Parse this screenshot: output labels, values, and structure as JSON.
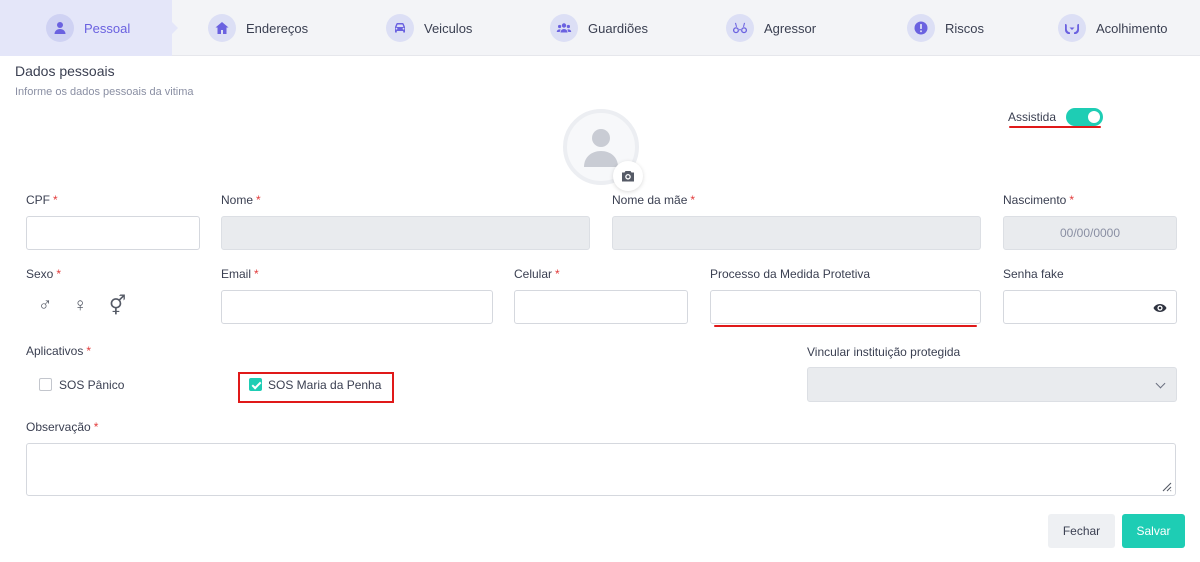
{
  "tabs": [
    {
      "label": "Pessoal",
      "icon": "user-icon"
    },
    {
      "label": "Endereços",
      "icon": "home-icon"
    },
    {
      "label": "Veiculos",
      "icon": "car-icon"
    },
    {
      "label": "Guardiões",
      "icon": "group-icon"
    },
    {
      "label": "Agressor",
      "icon": "glasses-icon"
    },
    {
      "label": "Riscos",
      "icon": "alert-icon"
    },
    {
      "label": "Acolhimento",
      "icon": "hands-icon"
    }
  ],
  "active_tab": "Pessoal",
  "section": {
    "title": "Dados pessoais",
    "subtitle": "Informe os dados pessoais da vitima"
  },
  "assistida": {
    "label": "Assistida",
    "enabled": true
  },
  "fields": {
    "cpf": {
      "label": "CPF",
      "value": ""
    },
    "nome": {
      "label": "Nome",
      "value": ""
    },
    "nome_mae": {
      "label": "Nome da mãe",
      "value": ""
    },
    "nascimento": {
      "label": "Nascimento",
      "placeholder": "00/00/0000"
    },
    "sexo": {
      "label": "Sexo",
      "options": [
        "♂",
        "♀",
        "⚥"
      ]
    },
    "email": {
      "label": "Email",
      "value": ""
    },
    "celular": {
      "label": "Celular",
      "value": ""
    },
    "processo": {
      "label": "Processo da Medida Protetiva",
      "value": ""
    },
    "senha_fake": {
      "label": "Senha fake",
      "value": ""
    },
    "aplicativos": {
      "label": "Aplicativos",
      "options": [
        {
          "label": "SOS Pânico",
          "checked": false
        },
        {
          "label": "SOS Maria da Penha",
          "checked": true
        }
      ]
    },
    "vincular": {
      "label": "Vincular instituição protegida",
      "value": ""
    },
    "observacao": {
      "label": "Observação",
      "value": ""
    }
  },
  "required_mark": "*",
  "buttons": {
    "fechar": "Fechar",
    "salvar": "Salvar"
  },
  "colors": {
    "accent": "#6a61e0",
    "teal": "#1ecdb4",
    "highlight": "#e01919"
  }
}
